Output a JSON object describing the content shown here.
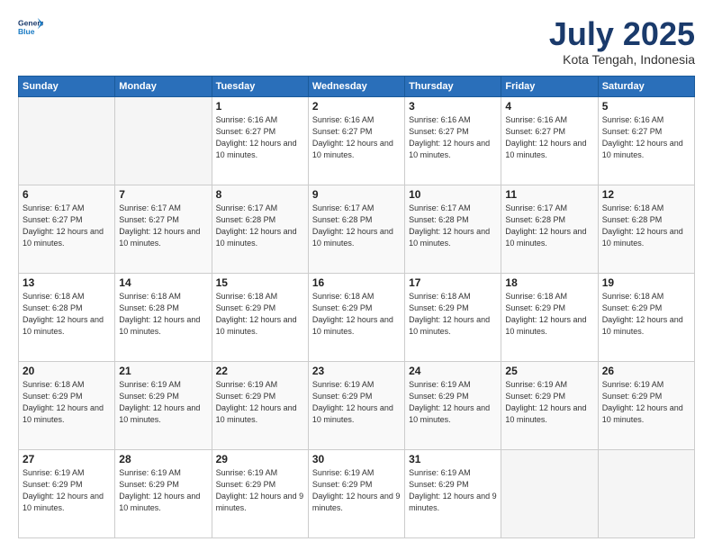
{
  "logo": {
    "line1": "General",
    "line2": "Blue"
  },
  "header": {
    "month": "July 2025",
    "location": "Kota Tengah, Indonesia"
  },
  "weekdays": [
    "Sunday",
    "Monday",
    "Tuesday",
    "Wednesday",
    "Thursday",
    "Friday",
    "Saturday"
  ],
  "weeks": [
    [
      {
        "day": "",
        "info": ""
      },
      {
        "day": "",
        "info": ""
      },
      {
        "day": "1",
        "info": "Sunrise: 6:16 AM\nSunset: 6:27 PM\nDaylight: 12 hours\nand 10 minutes."
      },
      {
        "day": "2",
        "info": "Sunrise: 6:16 AM\nSunset: 6:27 PM\nDaylight: 12 hours\nand 10 minutes."
      },
      {
        "day": "3",
        "info": "Sunrise: 6:16 AM\nSunset: 6:27 PM\nDaylight: 12 hours\nand 10 minutes."
      },
      {
        "day": "4",
        "info": "Sunrise: 6:16 AM\nSunset: 6:27 PM\nDaylight: 12 hours\nand 10 minutes."
      },
      {
        "day": "5",
        "info": "Sunrise: 6:16 AM\nSunset: 6:27 PM\nDaylight: 12 hours\nand 10 minutes."
      }
    ],
    [
      {
        "day": "6",
        "info": "Sunrise: 6:17 AM\nSunset: 6:27 PM\nDaylight: 12 hours\nand 10 minutes."
      },
      {
        "day": "7",
        "info": "Sunrise: 6:17 AM\nSunset: 6:27 PM\nDaylight: 12 hours\nand 10 minutes."
      },
      {
        "day": "8",
        "info": "Sunrise: 6:17 AM\nSunset: 6:28 PM\nDaylight: 12 hours\nand 10 minutes."
      },
      {
        "day": "9",
        "info": "Sunrise: 6:17 AM\nSunset: 6:28 PM\nDaylight: 12 hours\nand 10 minutes."
      },
      {
        "day": "10",
        "info": "Sunrise: 6:17 AM\nSunset: 6:28 PM\nDaylight: 12 hours\nand 10 minutes."
      },
      {
        "day": "11",
        "info": "Sunrise: 6:17 AM\nSunset: 6:28 PM\nDaylight: 12 hours\nand 10 minutes."
      },
      {
        "day": "12",
        "info": "Sunrise: 6:18 AM\nSunset: 6:28 PM\nDaylight: 12 hours\nand 10 minutes."
      }
    ],
    [
      {
        "day": "13",
        "info": "Sunrise: 6:18 AM\nSunset: 6:28 PM\nDaylight: 12 hours\nand 10 minutes."
      },
      {
        "day": "14",
        "info": "Sunrise: 6:18 AM\nSunset: 6:28 PM\nDaylight: 12 hours\nand 10 minutes."
      },
      {
        "day": "15",
        "info": "Sunrise: 6:18 AM\nSunset: 6:29 PM\nDaylight: 12 hours\nand 10 minutes."
      },
      {
        "day": "16",
        "info": "Sunrise: 6:18 AM\nSunset: 6:29 PM\nDaylight: 12 hours\nand 10 minutes."
      },
      {
        "day": "17",
        "info": "Sunrise: 6:18 AM\nSunset: 6:29 PM\nDaylight: 12 hours\nand 10 minutes."
      },
      {
        "day": "18",
        "info": "Sunrise: 6:18 AM\nSunset: 6:29 PM\nDaylight: 12 hours\nand 10 minutes."
      },
      {
        "day": "19",
        "info": "Sunrise: 6:18 AM\nSunset: 6:29 PM\nDaylight: 12 hours\nand 10 minutes."
      }
    ],
    [
      {
        "day": "20",
        "info": "Sunrise: 6:18 AM\nSunset: 6:29 PM\nDaylight: 12 hours\nand 10 minutes."
      },
      {
        "day": "21",
        "info": "Sunrise: 6:19 AM\nSunset: 6:29 PM\nDaylight: 12 hours\nand 10 minutes."
      },
      {
        "day": "22",
        "info": "Sunrise: 6:19 AM\nSunset: 6:29 PM\nDaylight: 12 hours\nand 10 minutes."
      },
      {
        "day": "23",
        "info": "Sunrise: 6:19 AM\nSunset: 6:29 PM\nDaylight: 12 hours\nand 10 minutes."
      },
      {
        "day": "24",
        "info": "Sunrise: 6:19 AM\nSunset: 6:29 PM\nDaylight: 12 hours\nand 10 minutes."
      },
      {
        "day": "25",
        "info": "Sunrise: 6:19 AM\nSunset: 6:29 PM\nDaylight: 12 hours\nand 10 minutes."
      },
      {
        "day": "26",
        "info": "Sunrise: 6:19 AM\nSunset: 6:29 PM\nDaylight: 12 hours\nand 10 minutes."
      }
    ],
    [
      {
        "day": "27",
        "info": "Sunrise: 6:19 AM\nSunset: 6:29 PM\nDaylight: 12 hours\nand 10 minutes."
      },
      {
        "day": "28",
        "info": "Sunrise: 6:19 AM\nSunset: 6:29 PM\nDaylight: 12 hours\nand 10 minutes."
      },
      {
        "day": "29",
        "info": "Sunrise: 6:19 AM\nSunset: 6:29 PM\nDaylight: 12 hours\nand 9 minutes."
      },
      {
        "day": "30",
        "info": "Sunrise: 6:19 AM\nSunset: 6:29 PM\nDaylight: 12 hours\nand 9 minutes."
      },
      {
        "day": "31",
        "info": "Sunrise: 6:19 AM\nSunset: 6:29 PM\nDaylight: 12 hours\nand 9 minutes."
      },
      {
        "day": "",
        "info": ""
      },
      {
        "day": "",
        "info": ""
      }
    ]
  ]
}
